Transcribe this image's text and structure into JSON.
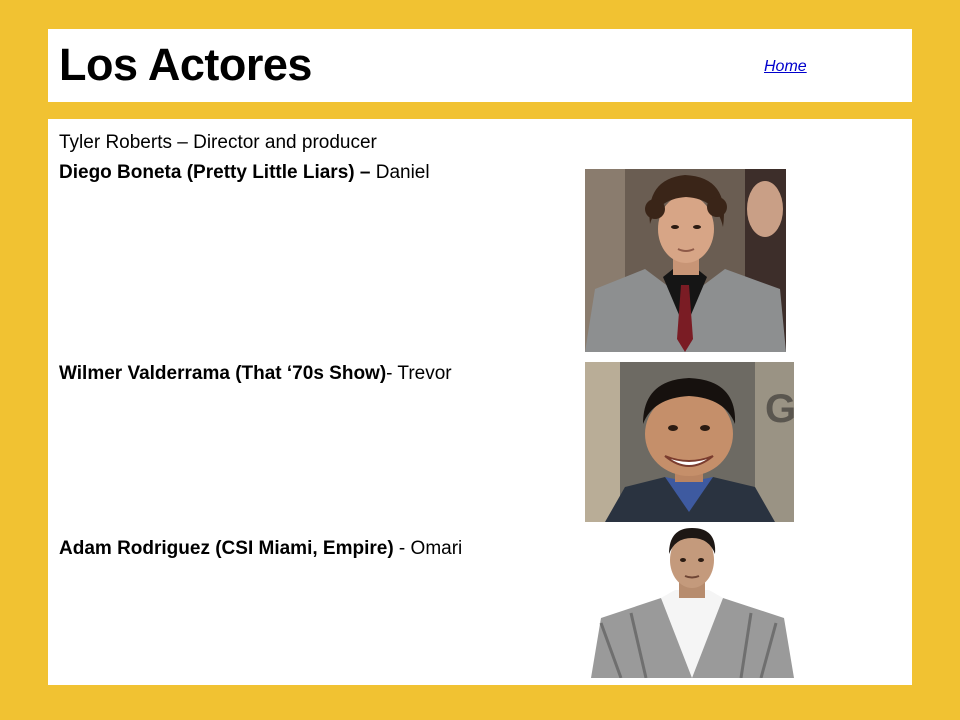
{
  "header": {
    "title": "Los Actores",
    "home_link": "Home"
  },
  "credits": [
    {
      "bold": "",
      "rest": "Tyler Roberts – Director and producer"
    },
    {
      "bold": "Diego Boneta (Pretty Little Liars) –",
      "rest": " Daniel"
    },
    {
      "bold": "Wilmer Valderrama (That ‘70s Show)",
      "rest": "- Trevor"
    },
    {
      "bold": "Adam Rodriguez (CSI Miami, Empire)",
      "rest": " - Omari"
    }
  ],
  "colors": {
    "background": "#F1C232",
    "panel": "#FFFFFF",
    "link": "#0000CC"
  },
  "icons": {
    "photos": [
      "diego-boneta-photo",
      "wilmer-valderrama-photo",
      "adam-rodriguez-photo"
    ]
  }
}
